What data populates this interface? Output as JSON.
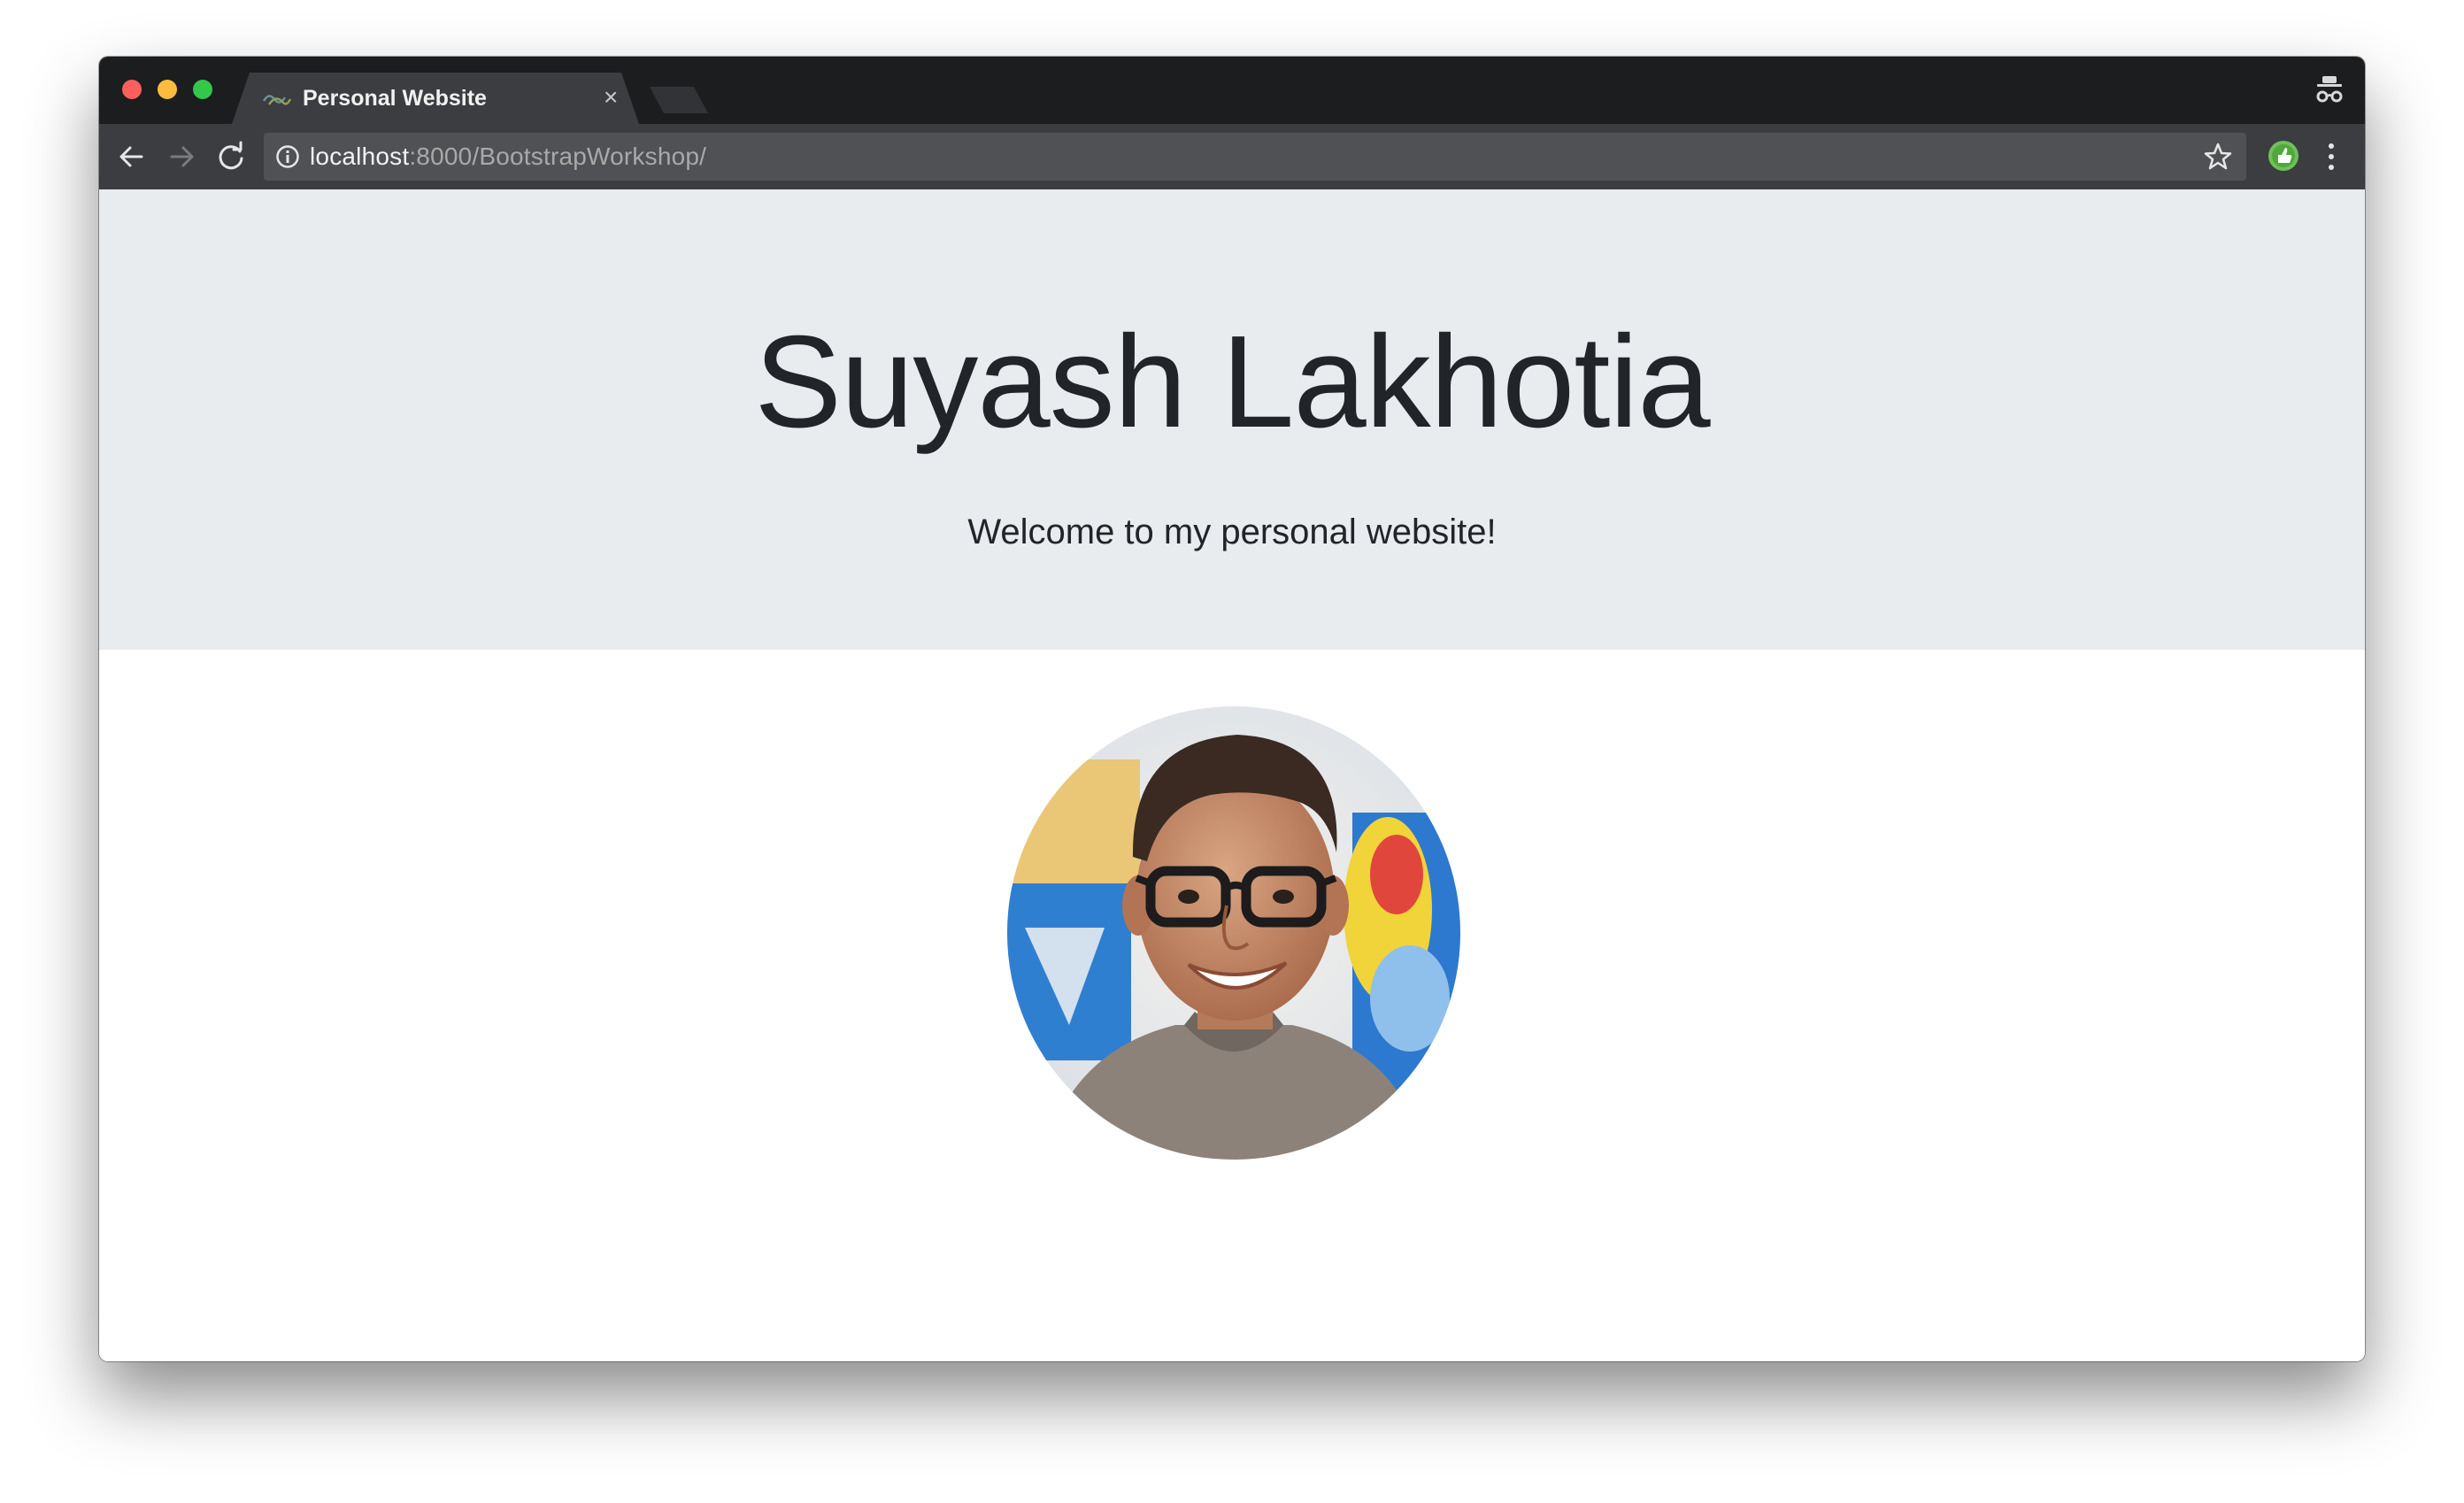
{
  "browser": {
    "tab_title": "Personal Website",
    "tab_close": "×",
    "url_host": "localhost",
    "url_rest": ":8000/BootstrapWorkshop/",
    "icons": {
      "back": "arrow-left-icon",
      "forward": "arrow-right-icon",
      "reload": "reload-icon",
      "info": "info-icon",
      "bookmark": "star-icon",
      "extension": "extension-icon",
      "menu": "kebab-menu-icon",
      "incognito": "incognito-icon"
    },
    "colors": {
      "titlebar": "#1c1d1f",
      "toolbar": "#3c3d40",
      "omnibox": "#505154"
    }
  },
  "page": {
    "hero_title": "Suyash Lakhotia",
    "hero_subtitle": "Welcome to my personal website!",
    "colors": {
      "jumbotron_bg": "#e9ecef",
      "text": "#212529"
    }
  }
}
